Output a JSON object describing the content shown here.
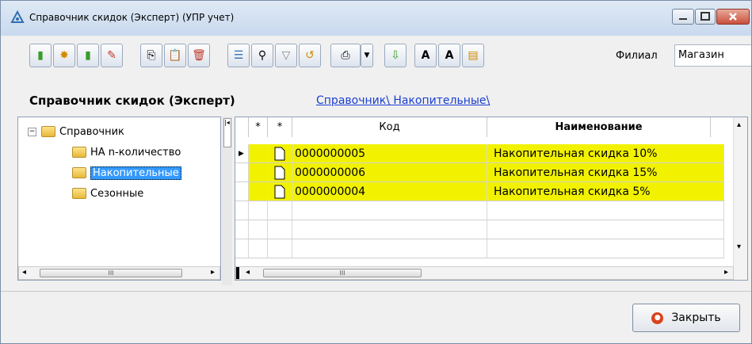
{
  "window": {
    "title": "Справочник скидок (Эксперт) (УПР учет)"
  },
  "toolbar": {
    "icons": [
      "add-icon",
      "add-group-icon",
      "copy-item-icon",
      "edit-icon",
      "copy-icon",
      "paste-icon",
      "delete-icon",
      "list-icon",
      "find-icon",
      "filter-icon",
      "refresh-icon",
      "print-icon",
      "print-menu-icon",
      "export-icon",
      "font-increase-icon",
      "font-decrease-icon",
      "calendar-icon"
    ],
    "branch_label": "Филиал",
    "branch_value": "Магазин"
  },
  "header": {
    "title": "Справочник скидок (Эксперт)",
    "breadcrumb": "Справочник\\ Накопительные\\"
  },
  "tree": {
    "items": [
      {
        "label": "Справочник"
      },
      {
        "label": "НА n-количество"
      },
      {
        "label": "Накопительные"
      },
      {
        "label": "Сезонные"
      }
    ]
  },
  "grid": {
    "columns": {
      "marker1": "*",
      "marker2": "*",
      "code": "Код",
      "name": "Наименование"
    },
    "rows": [
      {
        "code": "0000000005",
        "name": "Накопительная скидка 10%"
      },
      {
        "code": "0000000006",
        "name": "Накопительная скидка 15%"
      },
      {
        "code": "0000000004",
        "name": "Накопительная скидка 5%"
      }
    ],
    "row_highlight": "#f2f200"
  },
  "footer": {
    "close_label": "Закрыть"
  }
}
